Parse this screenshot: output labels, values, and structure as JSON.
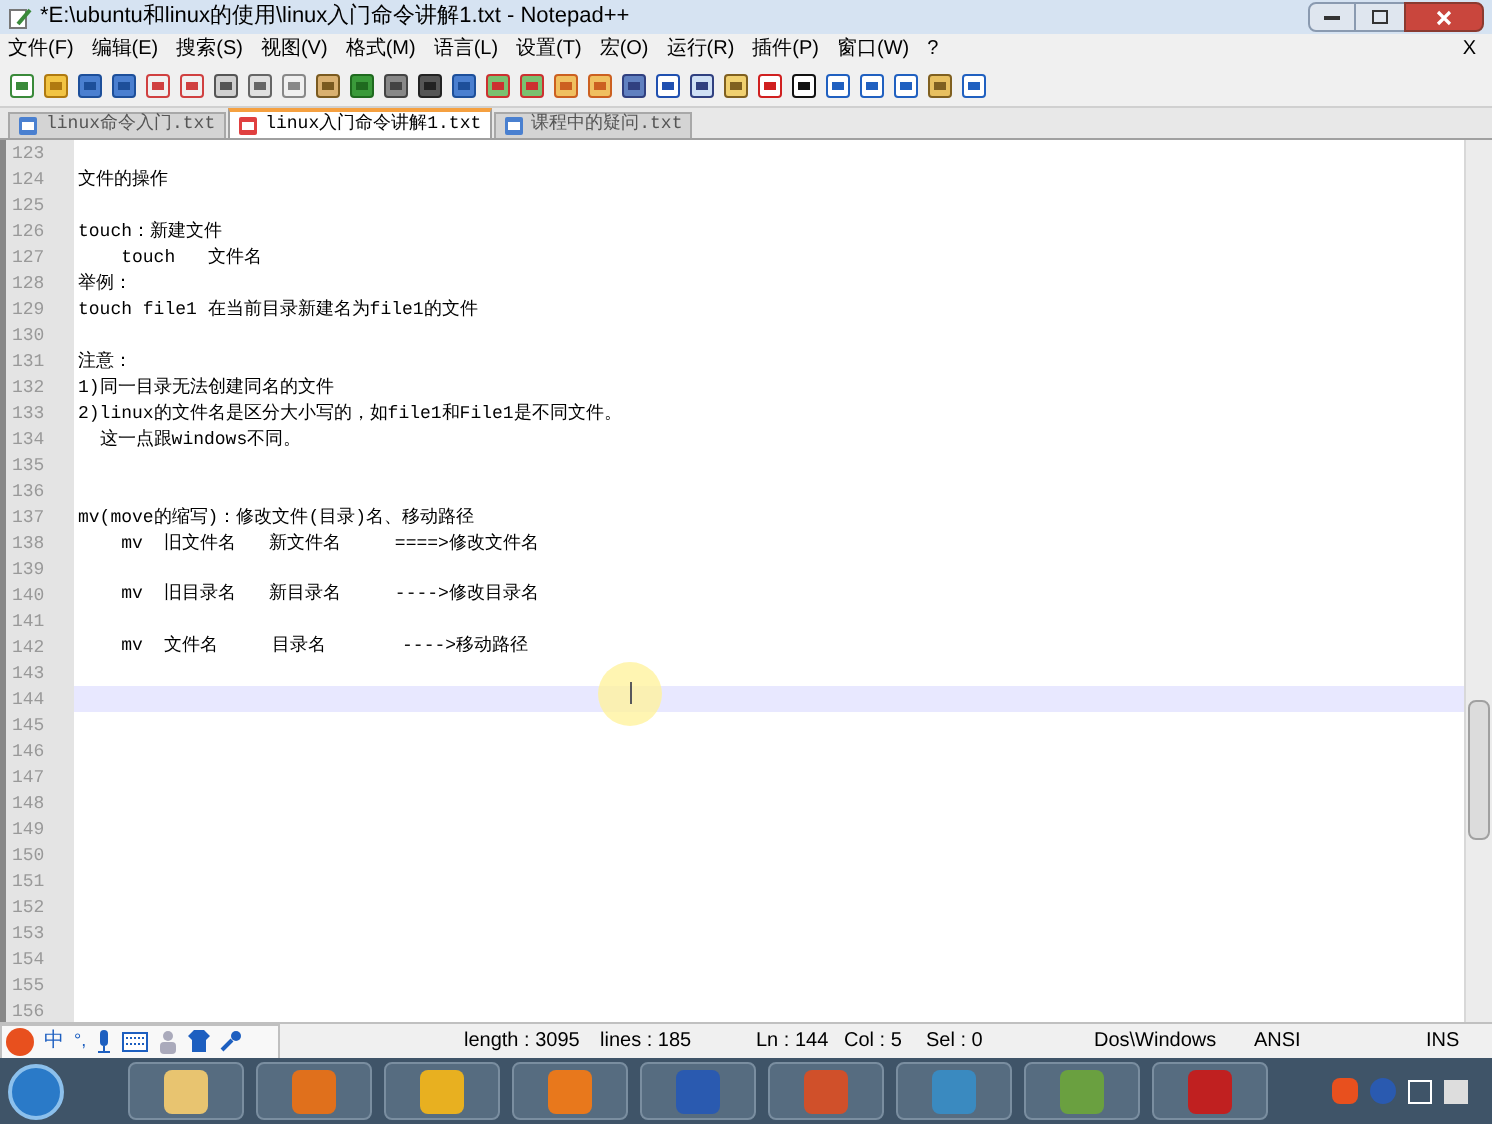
{
  "window": {
    "title": "*E:\\ubuntu和linux的使用\\linux入门命令讲解1.txt - Notepad++"
  },
  "menu": [
    "文件(F)",
    "编辑(E)",
    "搜索(S)",
    "视图(V)",
    "格式(M)",
    "语言(L)",
    "设置(T)",
    "宏(O)",
    "运行(R)",
    "插件(P)",
    "窗口(W)",
    "?"
  ],
  "menu_close": "X",
  "tabs": [
    {
      "label": "linux命令入门.txt",
      "selected": false,
      "modified": false
    },
    {
      "label": "linux入门命令讲解1.txt",
      "selected": true,
      "modified": true
    },
    {
      "label": "课程中的疑问.txt",
      "selected": false,
      "modified": false
    }
  ],
  "lines": [
    {
      "number": "123",
      "current": false
    },
    {
      "number": "124",
      "text": "文件的操作",
      "current": false
    },
    {
      "number": "125",
      "current": false
    },
    {
      "number": "126",
      "text": "touch：新建文件",
      "current": false
    },
    {
      "number": "127",
      "text": "    touch   文件名",
      "current": false
    },
    {
      "number": "128",
      "text": "举例：",
      "current": false
    },
    {
      "number": "129",
      "text": "touch file1 在当前目录新建名为file1的文件",
      "current": false
    },
    {
      "number": "130",
      "current": false
    },
    {
      "number": "131",
      "text": "注意：",
      "current": false
    },
    {
      "number": "132",
      "text": "1)同一目录无法创建同名的文件",
      "current": false
    },
    {
      "number": "133",
      "text": "2)linux的文件名是区分大小写的，如file1和File1是不同文件。",
      "current": false
    },
    {
      "number": "134",
      "text": "  这一点跟windows不同。",
      "current": false
    },
    {
      "number": "135",
      "current": false
    },
    {
      "number": "136",
      "current": false
    },
    {
      "number": "137",
      "text": "mv(move的缩写)：修改文件(目录)名、移动路径",
      "current": false
    },
    {
      "number": "138",
      "text": "    mv  旧文件名   新文件名     ====>修改文件名",
      "current": false
    },
    {
      "number": "139",
      "current": false
    },
    {
      "number": "140",
      "text": "    mv  旧目录名   新目录名     ---->修改目录名",
      "current": false
    },
    {
      "number": "141",
      "current": false
    },
    {
      "number": "142",
      "text": "    mv  文件名     目录名       ---->移动路径",
      "current": false
    },
    {
      "number": "143",
      "current": false
    },
    {
      "number": "144",
      "current": true
    },
    {
      "number": "145",
      "current": false
    },
    {
      "number": "146",
      "current": false
    },
    {
      "number": "147",
      "current": false
    },
    {
      "number": "148",
      "current": false
    },
    {
      "number": "149",
      "current": false
    },
    {
      "number": "150",
      "current": false
    },
    {
      "number": "151",
      "current": false
    },
    {
      "number": "152",
      "current": false
    },
    {
      "number": "153",
      "current": false
    },
    {
      "number": "154",
      "current": false
    },
    {
      "number": "155",
      "current": false
    },
    {
      "number": "156",
      "current": false
    }
  ],
  "ime_bar": {
    "mode": "中",
    "punctuation": "°,"
  },
  "status_bar": [
    "length : 3095",
    "lines : 185",
    "Ln : 144",
    "Col : 5",
    "Sel : 0",
    "Dos\\Windows",
    "ANSI",
    "INS"
  ]
}
